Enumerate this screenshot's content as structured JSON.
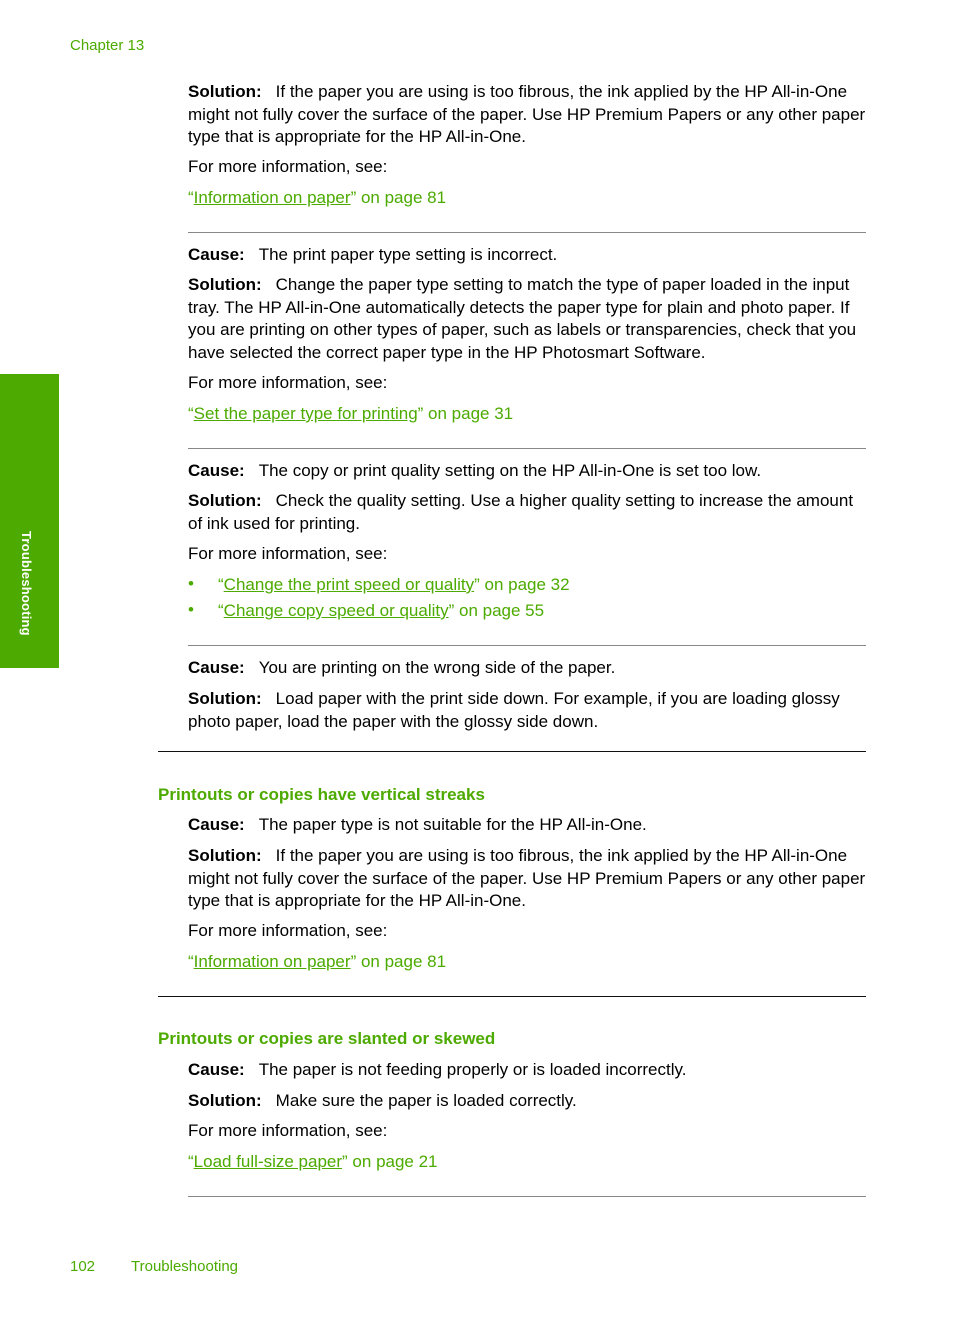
{
  "header": {
    "chapter": "Chapter 13"
  },
  "side_tab": {
    "label": "Troubleshooting",
    "color": "#4caa00"
  },
  "labels": {
    "cause": "Cause:",
    "solution": "Solution:",
    "more_info": "For more information, see:"
  },
  "blocks": [
    {
      "solution": "If the paper you are using is too fibrous, the ink applied by the HP All-in-One might not fully cover the surface of the paper. Use HP Premium Papers or any other paper type that is appropriate for the HP All-in-One.",
      "links": [
        {
          "open": "“",
          "text": "Information on paper",
          "close": "” on page 81"
        }
      ]
    },
    {
      "cause": "The print paper type setting is incorrect.",
      "solution": "Change the paper type setting to match the type of paper loaded in the input tray. The HP All-in-One automatically detects the paper type for plain and photo paper. If you are printing on other types of paper, such as labels or transparencies, check that you have selected the correct paper type in the HP Photosmart Software.",
      "links": [
        {
          "open": "“",
          "text": "Set the paper type for printing",
          "close": "” on page 31"
        }
      ]
    },
    {
      "cause": "The copy or print quality setting on the HP All-in-One is set too low.",
      "solution": "Check the quality setting. Use a higher quality setting to increase the amount of ink used for printing.",
      "links": [
        {
          "bullet": "•",
          "open": "“",
          "text": "Change the print speed or quality",
          "close": "” on page 32"
        },
        {
          "bullet": "•",
          "open": "“",
          "text": "Change copy speed or quality",
          "close": "” on page 55"
        }
      ]
    },
    {
      "cause": "You are printing on the wrong side of the paper.",
      "solution": "Load paper with the print side down. For example, if you are loading glossy photo paper, load the paper with the glossy side down."
    }
  ],
  "sections": [
    {
      "heading": "Printouts or copies have vertical streaks",
      "cause": "The paper type is not suitable for the HP All-in-One.",
      "solution": "If the paper you are using is too fibrous, the ink applied by the HP All-in-One might not fully cover the surface of the paper. Use HP Premium Papers or any other paper type that is appropriate for the HP All-in-One.",
      "links": [
        {
          "open": "“",
          "text": "Information on paper",
          "close": "” on page 81"
        }
      ]
    },
    {
      "heading": "Printouts or copies are slanted or skewed",
      "cause": "The paper is not feeding properly or is loaded incorrectly.",
      "solution": "Make sure the paper is loaded correctly.",
      "links": [
        {
          "open": "“",
          "text": "Load full-size paper",
          "close": "” on page 21"
        }
      ]
    }
  ],
  "footer": {
    "page_number": "102",
    "section": "Troubleshooting"
  }
}
